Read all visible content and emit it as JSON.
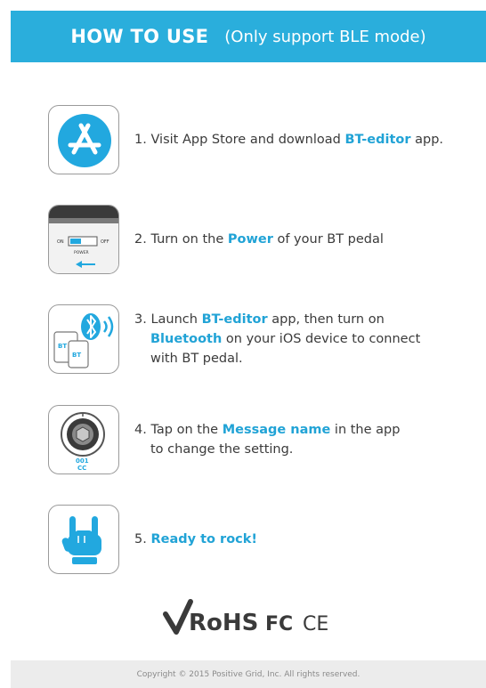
{
  "header": {
    "title": "HOW TO USE",
    "subtitle": "(Only support BLE mode)"
  },
  "steps": [
    {
      "icon": "app-store-icon",
      "parts": [
        "1. Visit App Store and download ",
        "BT-editor",
        " app."
      ]
    },
    {
      "icon": "power-switch-icon",
      "icon_labels": {
        "on": "ON",
        "off": "OFF",
        "power": "POWER"
      },
      "parts": [
        "2. Turn on the ",
        "Power",
        " of your BT pedal"
      ]
    },
    {
      "icon": "bluetooth-devices-icon",
      "icon_labels": {
        "bt1": "BT",
        "bt2": "BT"
      },
      "line1": [
        "3. Launch ",
        "BT-editor",
        " app, then turn on"
      ],
      "line2": [
        "Bluetooth",
        " on your iOS device to connect"
      ],
      "line3": "with BT pedal."
    },
    {
      "icon": "knob-dial-icon",
      "icon_labels": {
        "num": "001",
        "cc": "CC"
      },
      "line1": [
        "4. Tap on the ",
        "Message name",
        " in the app"
      ],
      "line2": "to change the setting."
    },
    {
      "icon": "rock-hand-icon",
      "parts": [
        "5. ",
        "Ready to rock!"
      ]
    }
  ],
  "certifications": {
    "rohs": "RoHS",
    "fc": "FC",
    "ce": "CE"
  },
  "footer": {
    "copyright": "Copyright © 2015 Positive Grid, Inc. All rights reserved."
  },
  "colors": {
    "accent": "#2aaedc",
    "highlight": "#21a3d6",
    "text": "#3b3b3b"
  }
}
